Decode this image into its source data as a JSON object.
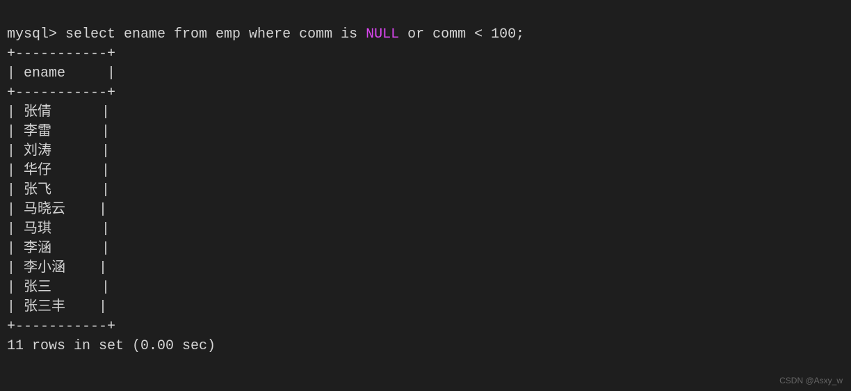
{
  "prompt": "mysql> ",
  "query": {
    "part1": "select ename from emp where comm is ",
    "null_keyword": "NULL",
    "part2": " or comm < 100;"
  },
  "table": {
    "border": "+-----------+",
    "header_row": "| ename     |",
    "rows": [
      "| 张倩      |",
      "| 李雷      |",
      "| 刘涛      |",
      "| 华仔      |",
      "| 张飞      |",
      "| 马晓云    |",
      "| 马琪      |",
      "| 李涵      |",
      "| 李小涵    |",
      "| 张三      |",
      "| 张三丰    |"
    ]
  },
  "status": "11 rows in set (0.00 sec)",
  "watermark": "CSDN @Asxy_w"
}
